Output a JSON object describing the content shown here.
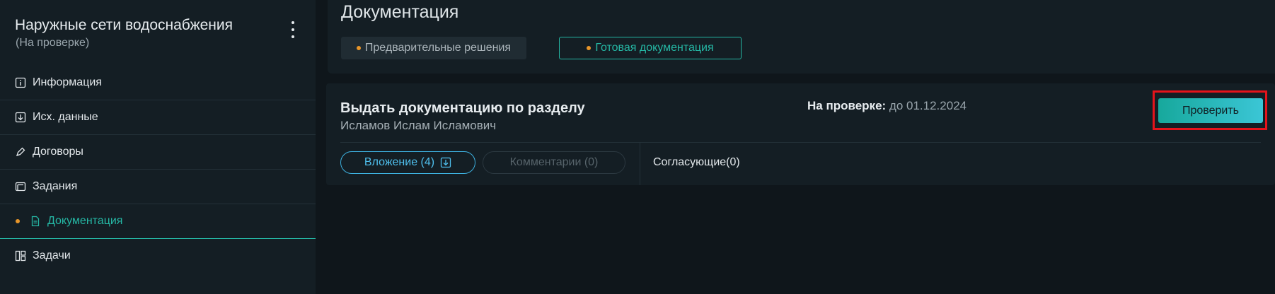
{
  "sidebar": {
    "project_title": "Наружные сети водоснабжения",
    "project_status": "(На проверке)",
    "items": [
      {
        "label": "Информация",
        "icon": "info-icon"
      },
      {
        "label": "Исх. данные",
        "icon": "download-box-icon"
      },
      {
        "label": "Договоры",
        "icon": "pen-icon"
      },
      {
        "label": "Задания",
        "icon": "folders-icon"
      },
      {
        "label": "Документация",
        "icon": "document-icon",
        "active": true
      },
      {
        "label": "Задачи",
        "icon": "board-icon"
      }
    ]
  },
  "documentation": {
    "title": "Документация",
    "tabs": [
      {
        "label": "Предварительные решения"
      },
      {
        "label": "Готовая документация",
        "selected": true
      }
    ]
  },
  "card": {
    "title": "Выдать документацию по разделу",
    "person": "Исламов Ислам Исламович",
    "review_label": "На проверке:",
    "review_date": "до 01.12.2024",
    "check_button": "Проверить",
    "attachments": "Вложение (4)",
    "comments": "Комментарии (0)",
    "approvers": "Согласующие(0)"
  },
  "colors": {
    "accent": "#25b7a4",
    "dot": "#e8962a",
    "highlight": "#e5141b",
    "link": "#4fc0ee"
  }
}
